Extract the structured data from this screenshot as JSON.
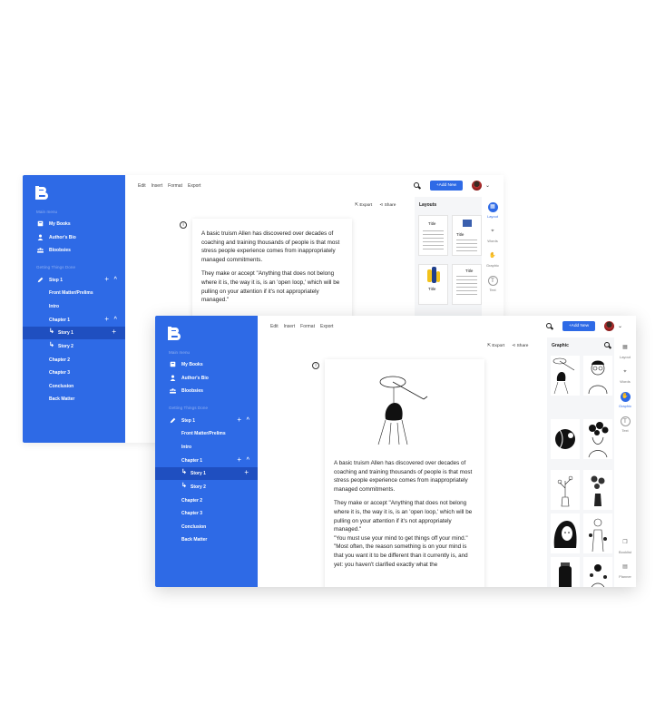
{
  "brand": {
    "color": "#2e6ae6",
    "logo_letter": "B"
  },
  "sidebar": {
    "main_menu_label": "Main menu",
    "main_items": [
      {
        "label": "My Books",
        "icon": "book-icon"
      },
      {
        "label": "Author's Bio",
        "icon": "person-icon"
      },
      {
        "label": "Bloobsies",
        "icon": "group-icon"
      }
    ],
    "book_label": "Getting Things Done",
    "tree": {
      "step": "Step 1",
      "front_matter": "Front Matter/Prelims",
      "intro": "Intro",
      "chapter1": "Chapter 1",
      "story1": "Story 1",
      "story2": "Story 2",
      "chapter2": "Chapter 2",
      "chapter3": "Chapter 3",
      "conclusion": "Conclusion",
      "back_matter": "Back Matter"
    }
  },
  "menubar": {
    "edit": "Edit",
    "insert": "Insert",
    "format": "Format",
    "export": "Export"
  },
  "header": {
    "add_new": "+Add New"
  },
  "toolbar": {
    "export": "Export",
    "share": "Share"
  },
  "document": {
    "p1": "A basic truism Allen has discovered over decades of coaching and training thousands of people is that most stress people experience comes from inappropriately managed commitments.",
    "p2": "They make or accept \"Anything that does not belong where it is, the way it is, is an 'open loop,' which will be pulling on your attention if it's not appropriately managed.\"",
    "p3": "\"You must use your mind to get things off your mind.\"",
    "p4": "\"Most often, the reason something is on your mind is that you want it to be different than it currently is, and yet: you haven't clarified exactly what the"
  },
  "layouts_panel": {
    "title": "Layouts",
    "thumb_title": "Title"
  },
  "graphic_panel": {
    "title": "Graphic"
  },
  "rail": {
    "layout": "Layout",
    "words": "Words",
    "graphic": "Graphic",
    "text": "Text",
    "booklist": "Booklist",
    "planner": "Planner"
  }
}
